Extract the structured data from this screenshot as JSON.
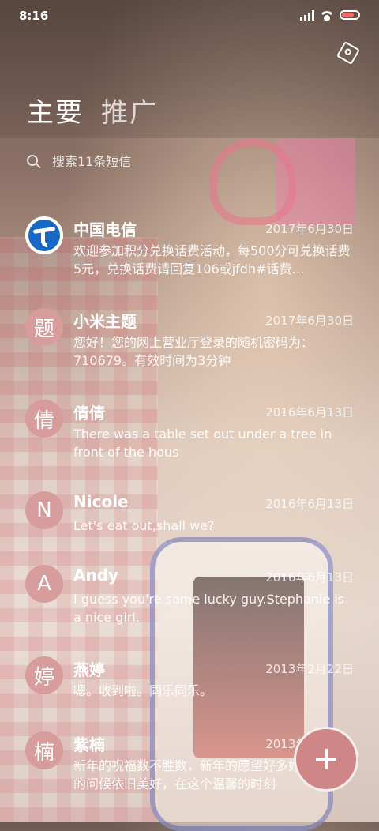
{
  "status_bar": {
    "time": "8:16",
    "battery_level": 0.75,
    "battery_color": "#f06a6a"
  },
  "header": {
    "tabs": [
      {
        "label": "主要",
        "active": true
      },
      {
        "label": "推广",
        "active": false
      }
    ],
    "settings_icon": "settings-hexagon-icon"
  },
  "search": {
    "placeholder": "搜索11条短信",
    "icon": "search-icon"
  },
  "conversations": [
    {
      "name": "中国电信",
      "date": "2017年6月30日",
      "preview": "欢迎参加积分兑换话费活动，每500分可兑换话费5元，兑换话费请回复106或jfdh#话费…",
      "avatar_type": "logo"
    },
    {
      "name": "小米主题",
      "date": "2017年6月30日",
      "preview": "您好！您的网上营业厅登录的随机密码为：710679。有效时间为3分钟",
      "avatar_letter": "题"
    },
    {
      "name": "倩倩",
      "date": "2016年6月13日",
      "preview": "There was a table set out under a tree in front of the hous",
      "avatar_letter": "倩"
    },
    {
      "name": "Nicole",
      "date": "2016年6月13日",
      "preview": "Let's eat out,shall we?",
      "avatar_letter": "N"
    },
    {
      "name": "Andy",
      "date": "2016年6月13日",
      "preview": "I guess you're some lucky guy.Stephanie is a nice girl.",
      "avatar_letter": "A"
    },
    {
      "name": "燕婷",
      "date": "2013年2月22日",
      "preview": "嗯。收到啦。同乐同乐。",
      "avatar_letter": "婷"
    },
    {
      "name": "紫楠",
      "date": "2013年2月22日",
      "preview": "新年的祝福数不胜数，新年的愿望好多好多，新年的问候依旧美好，在这个温馨的时刻",
      "avatar_letter": "楠"
    }
  ],
  "fab": {
    "icon": "plus-icon",
    "color": "#cf8686"
  },
  "colors": {
    "avatar_bg": "#d79c9c",
    "telecom_blue": "#1769c5"
  }
}
